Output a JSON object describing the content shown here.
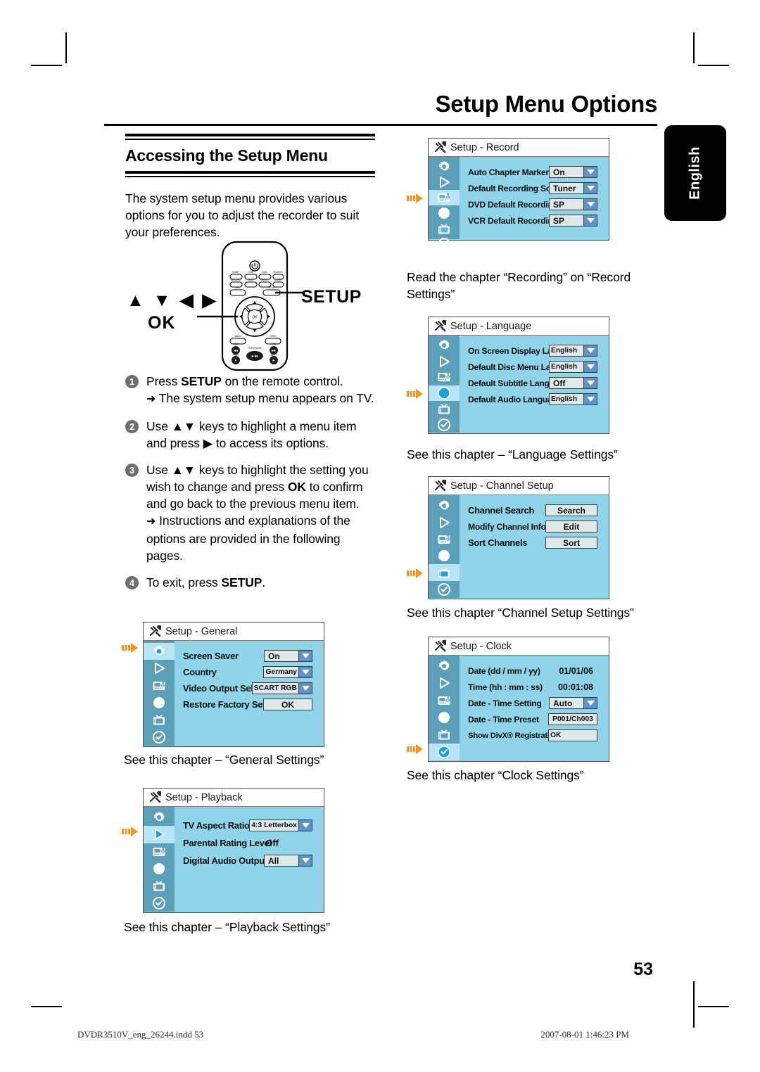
{
  "page": {
    "title": "Setup Menu Options",
    "language_tab": "English",
    "number": "53"
  },
  "left_column": {
    "section_heading": "Accessing the Setup Menu",
    "intro": "The system setup menu provides various options for you to adjust the recorder to suit your preferences.",
    "remote": {
      "keys_label": "▲ ▼ ◀ ▶",
      "ok_label": "OK",
      "setup_label": "SETUP"
    },
    "steps": [
      {
        "num": "1",
        "text_before": "Press ",
        "bold": "SETUP",
        "text_after": " on the remote control.",
        "sub": "The system setup menu appears on TV."
      },
      {
        "num": "2",
        "text_before": "Use ▲▼ keys to highlight a menu item and press ▶ to access its options.",
        "bold": "",
        "text_after": "",
        "sub": ""
      },
      {
        "num": "3",
        "text_before": "Use ▲▼ keys to highlight the setting you wish to change and press ",
        "bold": "OK",
        "text_after": " to confirm and go back to the previous menu item.",
        "sub": "Instructions and explanations of the options are provided in the following pages."
      },
      {
        "num": "4",
        "text_before": "To exit, press ",
        "bold": "SETUP",
        "text_after": ".",
        "sub": ""
      }
    ]
  },
  "panels": {
    "record": {
      "title": "Setup - Record",
      "active_index": 2,
      "rows": [
        {
          "label": "Auto Chapter Marker",
          "value": "On",
          "type": "dropdown"
        },
        {
          "label": "Default Recording Source",
          "value": "Tuner",
          "type": "dropdown"
        },
        {
          "label": "DVD Default Recording Mode",
          "value": "SP",
          "type": "dropdown"
        },
        {
          "label": "VCR Default Recording Mode",
          "value": "SP",
          "type": "dropdown"
        }
      ],
      "caption": "Read the chapter “Recording” on “Record Settings”"
    },
    "language": {
      "title": "Setup - Language",
      "active_index": 3,
      "rows": [
        {
          "label": "On Screen Display Language",
          "value": "English",
          "type": "dropdown"
        },
        {
          "label": "Default Disc Menu Language",
          "value": "English",
          "type": "dropdown"
        },
        {
          "label": "Default Subtitle Language",
          "value": "Off",
          "type": "dropdown"
        },
        {
          "label": "Default Audio Language",
          "value": "English",
          "type": "dropdown"
        }
      ],
      "caption": "See this chapter – “Language Settings”"
    },
    "channel": {
      "title": "Setup - Channel Setup",
      "active_index": 4,
      "rows": [
        {
          "label": "Channel Search",
          "value": "Search",
          "type": "button"
        },
        {
          "label": "Modify Channel Information",
          "value": "Edit",
          "type": "button"
        },
        {
          "label": "Sort Channels",
          "value": "Sort",
          "type": "button"
        }
      ],
      "caption": "See this chapter “Channel Setup Settings”"
    },
    "clock": {
      "title": "Setup - Clock",
      "active_index": 5,
      "rows": [
        {
          "label": "Date (dd / mm / yy)",
          "value": "01/01/06",
          "type": "plain"
        },
        {
          "label": "Time (hh : mm : ss)",
          "value": "00:01:08",
          "type": "plain"
        },
        {
          "label": "Date - Time Setting",
          "value": "Auto",
          "type": "dropdown"
        },
        {
          "label": "Date - Time Preset",
          "value": "P001/Ch003",
          "type": "field"
        },
        {
          "label": "Show DivX® Registration Code",
          "value": "OK",
          "type": "field"
        }
      ],
      "caption": "See this chapter “Clock Settings”"
    },
    "general": {
      "title": "Setup - General",
      "active_index": 0,
      "rows": [
        {
          "label": "Screen Saver",
          "value": "On",
          "type": "dropdown"
        },
        {
          "label": "Country",
          "value": "Germany",
          "type": "dropdown"
        },
        {
          "label": "Video Output Selection",
          "value": "SCART RGB",
          "type": "dropdown"
        },
        {
          "label": "Restore Factory Settings",
          "value": "OK",
          "type": "button"
        }
      ],
      "caption": "See this chapter – “General Settings”"
    },
    "playback": {
      "title": "Setup - Playback",
      "active_index": 1,
      "rows": [
        {
          "label": "TV Aspect Ratio",
          "value": "4:3 Letterbox",
          "type": "dropdown"
        },
        {
          "label": "Parental Rating Level",
          "value": "Off",
          "type": "plain"
        },
        {
          "label": "Digital Audio Output",
          "value": "All",
          "type": "dropdown"
        }
      ],
      "caption": "See this chapter – “Playback Settings”"
    }
  },
  "rail_icons": [
    "gear-icon",
    "play-icon",
    "record-icon",
    "disc-icon",
    "tv-icon",
    "clock-icon"
  ],
  "footer": {
    "left": "DVDR3510V_eng_26244.indd   53",
    "right": "2007-08-01   1:46:23 PM"
  },
  "colors": {
    "osd_bg": "#8fd4e8",
    "osd_rail": "#5c9fb8",
    "osd_rail_active": "#b8e4f5",
    "pointer": "#f7941e",
    "dropdown_button": "#5d93c9"
  }
}
